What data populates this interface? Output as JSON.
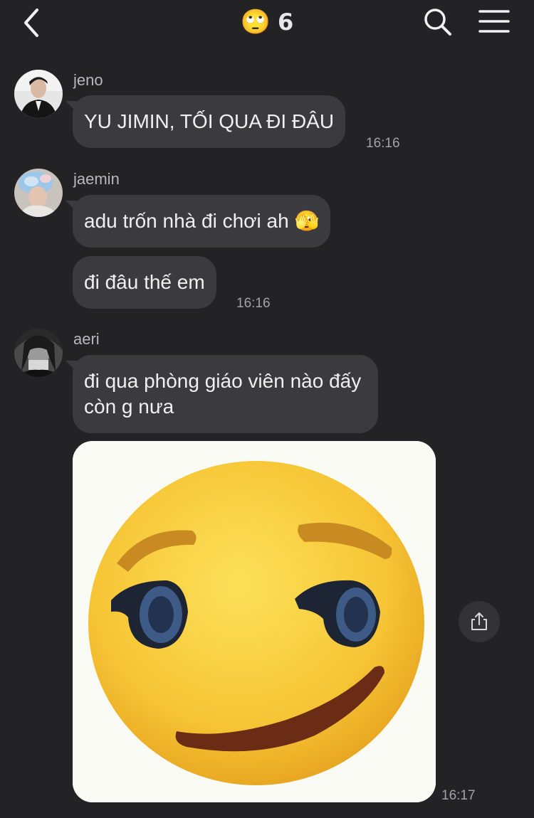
{
  "header": {
    "title_emoji": "🙄",
    "member_count": "6",
    "back_icon": "chevron-left-icon",
    "search_icon": "search-icon",
    "menu_icon": "hamburger-menu-icon"
  },
  "messages": [
    {
      "sender": "jeno",
      "text": "YU JIMIN, TỐI QUA ĐI ĐÂU",
      "time": "16:16"
    },
    {
      "sender": "jaemin",
      "text": "adu trốn nhà đi chơi ah 🫣"
    },
    {
      "text": "đi đâu thế em",
      "time": "16:16"
    },
    {
      "sender": "aeri",
      "text": "đi qua phòng giáo viên nào đấy\ncòn g nưa"
    },
    {
      "image": "smirking-face-emoji-image",
      "time": "16:17"
    }
  ],
  "colors": {
    "background": "#232325",
    "bubble": "#3b3b3f",
    "text": "#f0f0f0",
    "meta_text": "#a2a2a6"
  }
}
